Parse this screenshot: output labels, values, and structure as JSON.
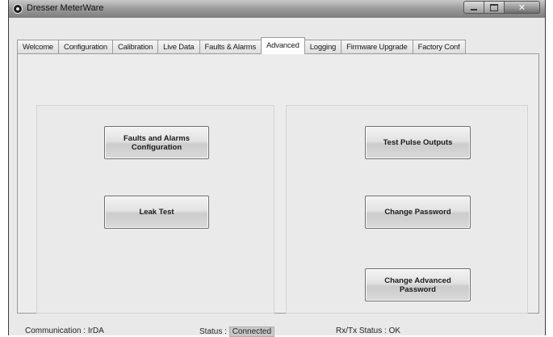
{
  "window": {
    "title": "Dresser MeterWare"
  },
  "tabs": [
    {
      "label": "Welcome"
    },
    {
      "label": "Configuration"
    },
    {
      "label": "Calibration"
    },
    {
      "label": "Live Data"
    },
    {
      "label": "Faults & Alarms"
    },
    {
      "label": "Advanced",
      "active": true
    },
    {
      "label": "Logging"
    },
    {
      "label": "Firmware Upgrade"
    },
    {
      "label": "Factory Conf"
    }
  ],
  "advanced": {
    "left_buttons": {
      "faults_alarms_config": "Faults and Alarms\nConfiguration",
      "leak_test": "Leak Test"
    },
    "right_buttons": {
      "test_pulse_outputs": "Test Pulse Outputs",
      "change_password": "Change Password",
      "change_advanced_password": "Change Advanced\nPassword"
    }
  },
  "status": {
    "communication_label": "Communication :",
    "communication_value": "IrDA",
    "status_label": "Status :",
    "status_value": "Connected",
    "rxtx_label": "Rx/Tx Status :",
    "rxtx_value": "OK"
  },
  "icons": {
    "app": "app-icon",
    "minimize": "minimize-icon",
    "maximize": "maximize-icon",
    "close": "close-icon"
  }
}
